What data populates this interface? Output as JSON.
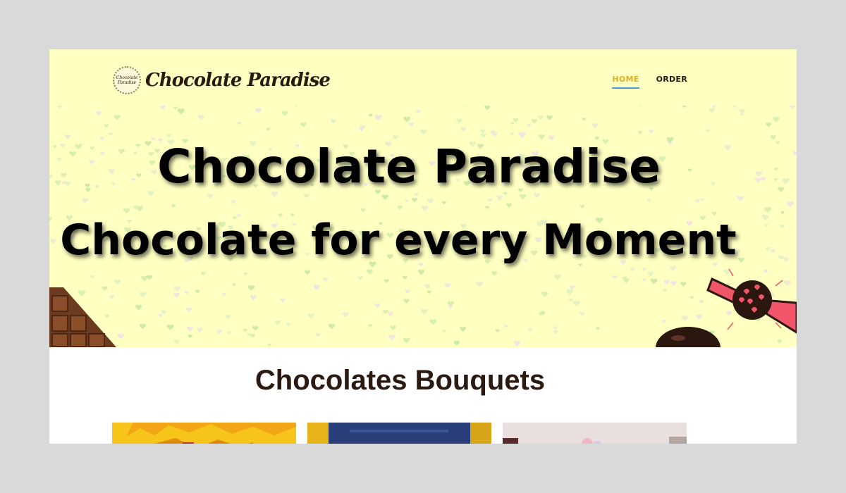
{
  "header": {
    "logo_badge_line1": "Chocolate",
    "logo_badge_line2": "Paradise",
    "logo_text": "Chocolate Paradise"
  },
  "nav": {
    "items": [
      {
        "label": "HOME",
        "active": true
      },
      {
        "label": "ORDER",
        "active": false
      }
    ]
  },
  "hero": {
    "title_line1": "Chocolate Paradise",
    "title_line2": "Chocolate for every Moment"
  },
  "section": {
    "title": "Chocolates Bouquets"
  },
  "colors": {
    "hero_background": "#ffffc2",
    "brand_dark": "#2b1a12",
    "nav_active": "#e0b02a",
    "nav_underline": "#4aa0d8",
    "page_backdrop": "#d9d9d9"
  },
  "cards": [
    {
      "icon": "bouquet-image-yellow"
    },
    {
      "icon": "bouquet-image-blue"
    },
    {
      "icon": "bouquet-image-pink"
    }
  ]
}
